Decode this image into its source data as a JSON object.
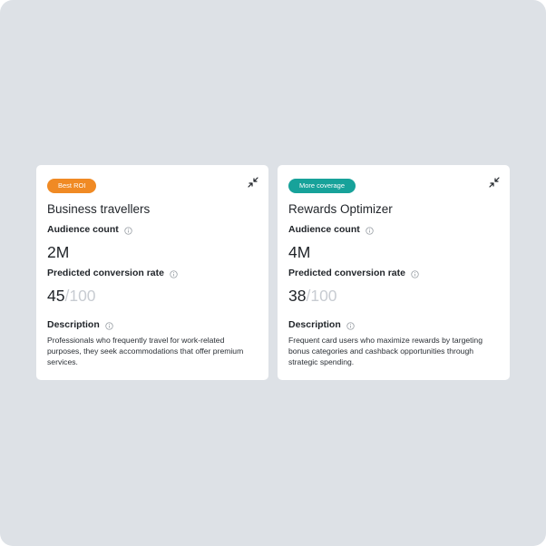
{
  "cards": [
    {
      "badge": "Best ROI",
      "badge_color": "#f08a24",
      "title": "Business travellers",
      "audience_label": "Audience count",
      "audience_value": "2M",
      "conversion_label": "Predicted conversion rate",
      "conversion_value": "45",
      "conversion_max": "/100",
      "description_label": "Description",
      "description": "Professionals who frequently travel for work-related purposes, they seek accommodations that offer premium services."
    },
    {
      "badge": "More coverage",
      "badge_color": "#17a29a",
      "title": "Rewards Optimizer",
      "audience_label": "Audience count",
      "audience_value": "4M",
      "conversion_label": "Predicted conversion rate",
      "conversion_value": "38",
      "conversion_max": "/100",
      "description_label": "Description",
      "description": "Frequent card users who maximize rewards by targeting bonus categories and cashback opportunities through strategic spending."
    }
  ],
  "icons": {
    "collapse": "collapse-arrows-icon",
    "info": "info-icon"
  }
}
